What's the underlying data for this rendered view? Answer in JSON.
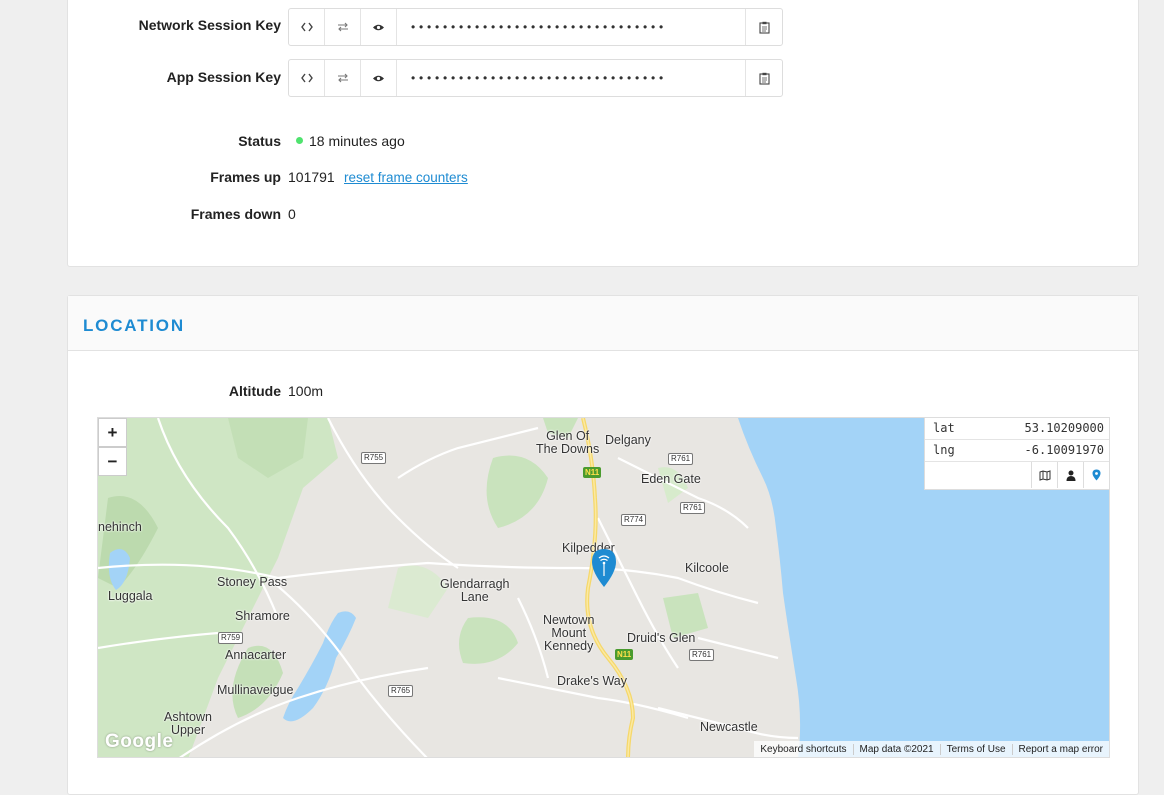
{
  "session": {
    "network_key_label": "Network Session Key",
    "app_key_label": "App Session Key",
    "masked_value": "••••••••••••••••••••••••••••••••"
  },
  "status": {
    "label": "Status",
    "value": "18 minutes ago",
    "color": "#4fe36e"
  },
  "frames": {
    "up_label": "Frames up",
    "up_value": "101791",
    "reset_link": "reset frame counters",
    "down_label": "Frames down",
    "down_value": "0"
  },
  "location": {
    "title": "LOCATION",
    "altitude_label": "Altitude",
    "altitude_value": "100m",
    "lat_label": "lat",
    "lat_value": "53.10209000",
    "lng_label": "lng",
    "lng_value": "-6.10091970"
  },
  "map": {
    "zoom_in": "+",
    "zoom_out": "−",
    "places": {
      "glen": "Glen Of\nThe Downs",
      "delgany": "Delgany",
      "eden_gate": "Eden Gate",
      "kilpedder": "Kilpedder",
      "kilcoole": "Kilcoole",
      "glendarragh": "Glendarragh\nLane",
      "newtown": "Newtown\nMount\nKennedy",
      "druids_glen": "Druid's Glen",
      "drakes_way": "Drake's Way",
      "newcastle": "Newcastle",
      "stoney_pass": "Stoney Pass",
      "luggala": "Luggala",
      "shramore": "Shramore",
      "annacarter": "Annacarter",
      "mullinaveigue": "Mullinaveigue",
      "ashtown": "Ashtown\nUpper",
      "hehinch": "nehinch"
    },
    "roads": {
      "r755": "R755",
      "r761a": "R761",
      "r761b": "R761",
      "r761c": "R761",
      "r774": "R774",
      "r759": "R759",
      "r765": "R765",
      "n11a": "N11",
      "n11b": "N11"
    },
    "logo": "Google",
    "attribution": {
      "shortcuts": "Keyboard shortcuts",
      "data": "Map data ©2021",
      "terms": "Terms of Use",
      "report": "Report a map error"
    }
  },
  "colors": {
    "accent": "#1e8bd2",
    "sea": "#a3d3f7",
    "green": "#cfe8c3"
  }
}
